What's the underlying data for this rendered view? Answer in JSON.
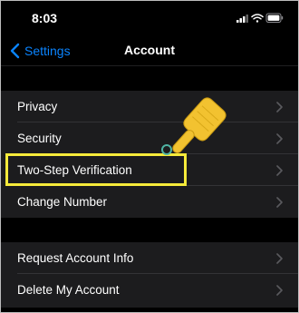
{
  "status_bar": {
    "time": "8:03",
    "icons": [
      "signal-icon",
      "wifi-icon",
      "battery-icon"
    ]
  },
  "nav": {
    "back_label": "Settings",
    "title": "Account"
  },
  "groups": [
    {
      "items": [
        {
          "label": "Privacy"
        },
        {
          "label": "Security"
        },
        {
          "label": "Two-Step Verification",
          "highlighted": true
        },
        {
          "label": "Change Number"
        }
      ]
    },
    {
      "items": [
        {
          "label": "Request Account Info"
        },
        {
          "label": "Delete My Account"
        }
      ]
    }
  ],
  "colors": {
    "background": "#000000",
    "row_background": "#1c1c1e",
    "accent": "#0a84ff",
    "highlight": "#f5ea3a",
    "pointer": "#f2c230"
  }
}
